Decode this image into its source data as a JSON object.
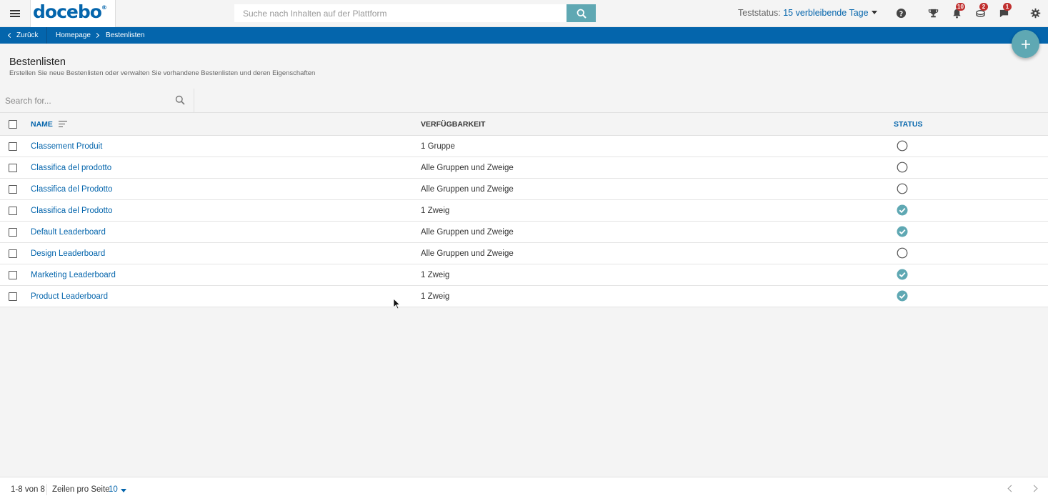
{
  "topbar": {
    "logo_text": "docebo",
    "logo_reg": "®",
    "search_placeholder": "Suche nach Inhalten auf der Plattform",
    "trial_prefix": "Teststatus: ",
    "trial_days": "15 verbleibende Tage",
    "notifications_badge": "10",
    "badge_2": "2",
    "messages_badge": "1"
  },
  "breadcrumb": {
    "back": "Zurück",
    "home": "Homepage",
    "current": "Bestenlisten"
  },
  "page": {
    "title": "Bestenlisten",
    "subtitle": "Erstellen Sie neue Bestenlisten oder verwalten Sie vorhandene Bestenlisten und deren Eigenschaften",
    "filter_placeholder": "Search for..."
  },
  "table": {
    "headers": {
      "name": "NAME",
      "availability": "VERFÜGBARKEIT",
      "status": "STATUS"
    },
    "rows": [
      {
        "name": "Classement Produit",
        "availability": "1 Gruppe",
        "active": false
      },
      {
        "name": "Classifica del prodotto",
        "availability": "Alle Gruppen und Zweige",
        "active": false
      },
      {
        "name": "Classifica del Prodotto",
        "availability": "Alle Gruppen und Zweige",
        "active": false
      },
      {
        "name": "Classifica del Prodotto",
        "availability": "1 Zweig",
        "active": true
      },
      {
        "name": "Default Leaderboard",
        "availability": "Alle Gruppen und Zweige",
        "active": true
      },
      {
        "name": "Design Leaderboard",
        "availability": "Alle Gruppen und Zweige",
        "active": false
      },
      {
        "name": "Marketing Leaderboard",
        "availability": "1 Zweig",
        "active": true
      },
      {
        "name": "Product Leaderboard",
        "availability": "1 Zweig",
        "active": true
      }
    ]
  },
  "footer": {
    "range": "1-8 von 8",
    "rows_per_page_label": "Zeilen pro Seite",
    "rows_per_page_value": "10"
  },
  "colors": {
    "brand_blue": "#0465ac",
    "teal": "#5fa8b3",
    "badge_red": "#c0302f"
  },
  "icons": [
    "menu-icon",
    "search-icon",
    "help-icon",
    "trophy-icon",
    "bell-icon",
    "coins-icon",
    "chat-icon",
    "gear-icon",
    "plus-icon",
    "check-circle-icon",
    "empty-circle-icon",
    "sort-icon",
    "chevron-left-icon",
    "chevron-right-icon"
  ]
}
